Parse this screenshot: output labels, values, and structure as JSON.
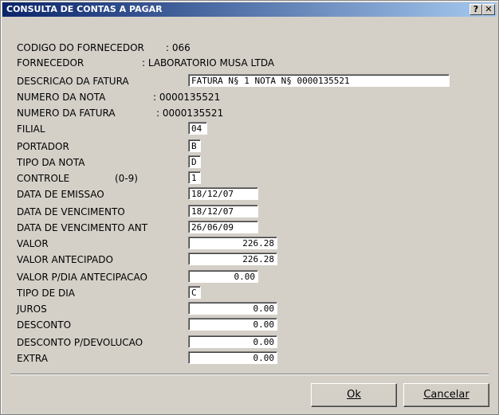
{
  "window": {
    "title": "CONSULTA DE CONTAS A PAGAR",
    "help_label": "?",
    "close_label": "✕"
  },
  "info": {
    "codigo_label": "CODIGO DO FORNECEDOR",
    "codigo_value": ": 066",
    "fornecedor_label": "FORNECEDOR",
    "fornecedor_value": ": LABORATORIO MUSA LTDA",
    "numero_nota_label": "NUMERO DA NOTA",
    "numero_nota_value": ": 0000135521",
    "numero_fatura_label": "NUMERO DA FATURA",
    "numero_fatura_value": ": 0000135521"
  },
  "fields": {
    "descricao": {
      "label": "DESCRICAO DA FATURA",
      "value": "FATURA N§ 1 NOTA N§ 0000135521"
    },
    "filial": {
      "label": "FILIAL",
      "value": "04"
    },
    "portador": {
      "label": "PORTADOR",
      "value": "B"
    },
    "tipo_nota": {
      "label": "TIPO DA NOTA",
      "value": "D"
    },
    "controle": {
      "label": "CONTROLE",
      "hint": "(0-9)",
      "value": "1"
    },
    "data_emissao": {
      "label": "DATA DE EMISSAO",
      "value": "18/12/07"
    },
    "data_vencimento": {
      "label": "DATA DE VENCIMENTO",
      "value": "18/12/07"
    },
    "data_vencimento_ant": {
      "label": "DATA DE VENCIMENTO ANT",
      "value": "26/06/09"
    },
    "valor": {
      "label": "VALOR",
      "value": "226.28"
    },
    "valor_antecipado": {
      "label": "VALOR ANTECIPADO",
      "value": "226.28"
    },
    "valor_dia": {
      "label": "VALOR P/DIA ANTECIPACAO",
      "value": "0.00"
    },
    "tipo_dia": {
      "label": "TIPO DE DIA",
      "value": "C"
    },
    "juros": {
      "label": "JUROS",
      "value": "0.00"
    },
    "desconto": {
      "label": "DESCONTO",
      "value": "0.00"
    },
    "desconto_devolucao": {
      "label": "DESCONTO P/DEVOLUCAO",
      "value": "0.00"
    },
    "extra": {
      "label": "EXTRA",
      "value": "0.00"
    }
  },
  "buttons": {
    "ok": "Ok",
    "cancel": "Cancelar"
  }
}
